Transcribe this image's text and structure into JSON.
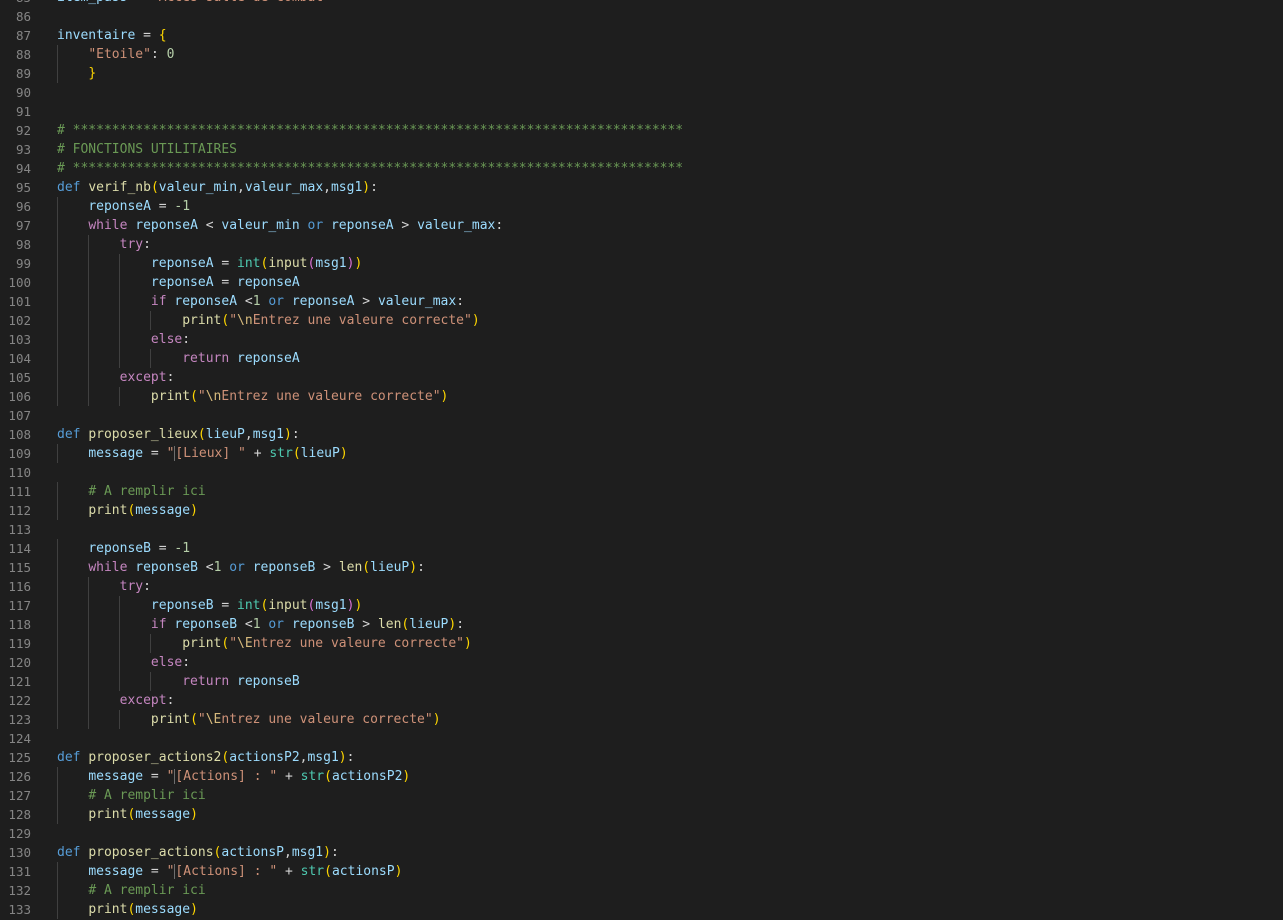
{
  "editor": {
    "background": "#1e1e1e",
    "language": "python",
    "first_line_number": 85,
    "palette": {
      "kw": "#569cd6",
      "ctl": "#c586c0",
      "fn": "#dcdcaa",
      "var": "#9cdcfe",
      "str": "#ce9178",
      "num": "#b5cea8",
      "cmt": "#6a9955",
      "bi": "#4ec9b0",
      "br1": "#ffd700",
      "br2": "#da70d6",
      "br3": "#179fff",
      "esc": "#d7ba7d"
    },
    "lines": [
      {
        "n": "85",
        "indent": 0,
        "tokens": [
          [
            "var",
            "item_pass"
          ],
          [
            "op",
            " = "
          ],
          [
            "str",
            "\"Accès salle de combat\""
          ]
        ]
      },
      {
        "n": "86",
        "indent": 0,
        "tokens": []
      },
      {
        "n": "87",
        "indent": 0,
        "tokens": [
          [
            "var",
            "inventaire"
          ],
          [
            "op",
            " = "
          ],
          [
            "br1",
            "{"
          ]
        ]
      },
      {
        "n": "88",
        "indent": 1,
        "tokens": [
          [
            "str",
            "\"Etoile\""
          ],
          [
            "op",
            ": "
          ],
          [
            "num",
            "0"
          ]
        ]
      },
      {
        "n": "89",
        "indent": 1,
        "tokens": [
          [
            "br1",
            "}"
          ]
        ]
      },
      {
        "n": "90",
        "indent": 0,
        "tokens": []
      },
      {
        "n": "91",
        "indent": 0,
        "tokens": []
      },
      {
        "n": "92",
        "indent": 0,
        "tokens": [
          [
            "cmt",
            "# ******************************************************************************"
          ]
        ]
      },
      {
        "n": "93",
        "indent": 0,
        "tokens": [
          [
            "cmt",
            "# FONCTIONS UTILITAIRES"
          ]
        ]
      },
      {
        "n": "94",
        "indent": 0,
        "tokens": [
          [
            "cmt",
            "# ******************************************************************************"
          ]
        ]
      },
      {
        "n": "95",
        "indent": 0,
        "tokens": [
          [
            "kw",
            "def"
          ],
          [
            "op",
            " "
          ],
          [
            "fn",
            "verif_nb"
          ],
          [
            "br1",
            "("
          ],
          [
            "var",
            "valeur_min"
          ],
          [
            "op",
            ","
          ],
          [
            "var",
            "valeur_max"
          ],
          [
            "op",
            ","
          ],
          [
            "var",
            "msg1"
          ],
          [
            "br1",
            ")"
          ],
          [
            "op",
            ":"
          ]
        ]
      },
      {
        "n": "96",
        "indent": 1,
        "tokens": [
          [
            "var",
            "reponseA"
          ],
          [
            "op",
            " = "
          ],
          [
            "num",
            "-1"
          ]
        ]
      },
      {
        "n": "97",
        "indent": 1,
        "tokens": [
          [
            "ctl",
            "while"
          ],
          [
            "op",
            " "
          ],
          [
            "var",
            "reponseA"
          ],
          [
            "op",
            " < "
          ],
          [
            "var",
            "valeur_min"
          ],
          [
            "op",
            " "
          ],
          [
            "kw",
            "or"
          ],
          [
            "op",
            " "
          ],
          [
            "var",
            "reponseA"
          ],
          [
            "op",
            " > "
          ],
          [
            "var",
            "valeur_max"
          ],
          [
            "op",
            ":"
          ]
        ]
      },
      {
        "n": "98",
        "indent": 2,
        "tokens": [
          [
            "ctl",
            "try"
          ],
          [
            "op",
            ":"
          ]
        ]
      },
      {
        "n": "99",
        "indent": 3,
        "tokens": [
          [
            "var",
            "reponseA"
          ],
          [
            "op",
            " = "
          ],
          [
            "bi",
            "int"
          ],
          [
            "br1",
            "("
          ],
          [
            "fn",
            "input"
          ],
          [
            "br2",
            "("
          ],
          [
            "var",
            "msg1"
          ],
          [
            "br2",
            ")"
          ],
          [
            "br1",
            ")"
          ]
        ]
      },
      {
        "n": "100",
        "indent": 3,
        "tokens": [
          [
            "var",
            "reponseA"
          ],
          [
            "op",
            " = "
          ],
          [
            "var",
            "reponseA"
          ]
        ]
      },
      {
        "n": "101",
        "indent": 3,
        "tokens": [
          [
            "ctl",
            "if"
          ],
          [
            "op",
            " "
          ],
          [
            "var",
            "reponseA"
          ],
          [
            "op",
            " <"
          ],
          [
            "num",
            "1"
          ],
          [
            "op",
            " "
          ],
          [
            "kw",
            "or"
          ],
          [
            "op",
            " "
          ],
          [
            "var",
            "reponseA"
          ],
          [
            "op",
            " > "
          ],
          [
            "var",
            "valeur_max"
          ],
          [
            "op",
            ":"
          ]
        ]
      },
      {
        "n": "102",
        "indent": 4,
        "tokens": [
          [
            "fn",
            "print"
          ],
          [
            "br1",
            "("
          ],
          [
            "str",
            "\""
          ],
          [
            "esc",
            "\\n"
          ],
          [
            "str",
            "Entrez une valeure correcte\""
          ],
          [
            "br1",
            ")"
          ]
        ]
      },
      {
        "n": "103",
        "indent": 3,
        "tokens": [
          [
            "ctl",
            "else"
          ],
          [
            "op",
            ":"
          ]
        ]
      },
      {
        "n": "104",
        "indent": 4,
        "tokens": [
          [
            "ctl",
            "return"
          ],
          [
            "op",
            " "
          ],
          [
            "var",
            "reponseA"
          ]
        ]
      },
      {
        "n": "105",
        "indent": 2,
        "tokens": [
          [
            "ctl",
            "except"
          ],
          [
            "op",
            ":"
          ]
        ]
      },
      {
        "n": "106",
        "indent": 3,
        "tokens": [
          [
            "fn",
            "print"
          ],
          [
            "br1",
            "("
          ],
          [
            "str",
            "\""
          ],
          [
            "esc",
            "\\n"
          ],
          [
            "str",
            "Entrez une valeure correcte\""
          ],
          [
            "br1",
            ")"
          ]
        ]
      },
      {
        "n": "107",
        "indent": 0,
        "tokens": []
      },
      {
        "n": "108",
        "indent": 0,
        "tokens": [
          [
            "kw",
            "def"
          ],
          [
            "op",
            " "
          ],
          [
            "fn",
            "proposer_lieux"
          ],
          [
            "br1",
            "("
          ],
          [
            "var",
            "lieuP"
          ],
          [
            "op",
            ","
          ],
          [
            "var",
            "msg1"
          ],
          [
            "br1",
            ")"
          ],
          [
            "op",
            ":"
          ]
        ]
      },
      {
        "n": "109",
        "indent": 1,
        "tokens": [
          [
            "var",
            "message"
          ],
          [
            "op",
            " = "
          ],
          [
            "str",
            "\""
          ],
          [
            "cur",
            ""
          ],
          [
            "str",
            "[Lieux] \""
          ],
          [
            "op",
            " + "
          ],
          [
            "bi",
            "str"
          ],
          [
            "br1",
            "("
          ],
          [
            "var",
            "lieuP"
          ],
          [
            "br1",
            ")"
          ]
        ]
      },
      {
        "n": "110",
        "indent": 0,
        "tokens": []
      },
      {
        "n": "111",
        "indent": 1,
        "tokens": [
          [
            "cmt",
            "# A remplir ici"
          ]
        ]
      },
      {
        "n": "112",
        "indent": 1,
        "tokens": [
          [
            "fn",
            "print"
          ],
          [
            "br1",
            "("
          ],
          [
            "var",
            "message"
          ],
          [
            "br1",
            ")"
          ]
        ]
      },
      {
        "n": "113",
        "indent": 0,
        "tokens": []
      },
      {
        "n": "114",
        "indent": 1,
        "tokens": [
          [
            "var",
            "reponseB"
          ],
          [
            "op",
            " = "
          ],
          [
            "num",
            "-1"
          ]
        ]
      },
      {
        "n": "115",
        "indent": 1,
        "tokens": [
          [
            "ctl",
            "while"
          ],
          [
            "op",
            " "
          ],
          [
            "var",
            "reponseB"
          ],
          [
            "op",
            " <"
          ],
          [
            "num",
            "1"
          ],
          [
            "op",
            " "
          ],
          [
            "kw",
            "or"
          ],
          [
            "op",
            " "
          ],
          [
            "var",
            "reponseB"
          ],
          [
            "op",
            " > "
          ],
          [
            "fn",
            "len"
          ],
          [
            "br1",
            "("
          ],
          [
            "var",
            "lieuP"
          ],
          [
            "br1",
            ")"
          ],
          [
            "op",
            ":"
          ]
        ]
      },
      {
        "n": "116",
        "indent": 2,
        "tokens": [
          [
            "ctl",
            "try"
          ],
          [
            "op",
            ":"
          ]
        ]
      },
      {
        "n": "117",
        "indent": 3,
        "tokens": [
          [
            "var",
            "reponseB"
          ],
          [
            "op",
            " = "
          ],
          [
            "bi",
            "int"
          ],
          [
            "br1",
            "("
          ],
          [
            "fn",
            "input"
          ],
          [
            "br2",
            "("
          ],
          [
            "var",
            "msg1"
          ],
          [
            "br2",
            ")"
          ],
          [
            "br1",
            ")"
          ]
        ]
      },
      {
        "n": "118",
        "indent": 3,
        "tokens": [
          [
            "ctl",
            "if"
          ],
          [
            "op",
            " "
          ],
          [
            "var",
            "reponseB"
          ],
          [
            "op",
            " <"
          ],
          [
            "num",
            "1"
          ],
          [
            "op",
            " "
          ],
          [
            "kw",
            "or"
          ],
          [
            "op",
            " "
          ],
          [
            "var",
            "reponseB"
          ],
          [
            "op",
            " > "
          ],
          [
            "fn",
            "len"
          ],
          [
            "br1",
            "("
          ],
          [
            "var",
            "lieuP"
          ],
          [
            "br1",
            ")"
          ],
          [
            "op",
            ":"
          ]
        ]
      },
      {
        "n": "119",
        "indent": 4,
        "tokens": [
          [
            "fn",
            "print"
          ],
          [
            "br1",
            "("
          ],
          [
            "str",
            "\""
          ],
          [
            "esc",
            "\\E"
          ],
          [
            "str",
            "ntrez une valeure correcte\""
          ],
          [
            "br1",
            ")"
          ]
        ]
      },
      {
        "n": "120",
        "indent": 3,
        "tokens": [
          [
            "ctl",
            "else"
          ],
          [
            "op",
            ":"
          ]
        ]
      },
      {
        "n": "121",
        "indent": 4,
        "tokens": [
          [
            "ctl",
            "return"
          ],
          [
            "op",
            " "
          ],
          [
            "var",
            "reponseB"
          ]
        ]
      },
      {
        "n": "122",
        "indent": 2,
        "tokens": [
          [
            "ctl",
            "except"
          ],
          [
            "op",
            ":"
          ]
        ]
      },
      {
        "n": "123",
        "indent": 3,
        "tokens": [
          [
            "fn",
            "print"
          ],
          [
            "br1",
            "("
          ],
          [
            "str",
            "\""
          ],
          [
            "esc",
            "\\E"
          ],
          [
            "str",
            "ntrez une valeure correcte\""
          ],
          [
            "br1",
            ")"
          ]
        ]
      },
      {
        "n": "124",
        "indent": 0,
        "tokens": []
      },
      {
        "n": "125",
        "indent": 0,
        "tokens": [
          [
            "kw",
            "def"
          ],
          [
            "op",
            " "
          ],
          [
            "fn",
            "proposer_actions2"
          ],
          [
            "br1",
            "("
          ],
          [
            "var",
            "actionsP2"
          ],
          [
            "op",
            ","
          ],
          [
            "var",
            "msg1"
          ],
          [
            "br1",
            ")"
          ],
          [
            "op",
            ":"
          ]
        ]
      },
      {
        "n": "126",
        "indent": 1,
        "tokens": [
          [
            "var",
            "message"
          ],
          [
            "op",
            " = "
          ],
          [
            "str",
            "\""
          ],
          [
            "cur",
            ""
          ],
          [
            "str",
            "[Actions] : \""
          ],
          [
            "op",
            " + "
          ],
          [
            "bi",
            "str"
          ],
          [
            "br1",
            "("
          ],
          [
            "var",
            "actionsP2"
          ],
          [
            "br1",
            ")"
          ]
        ]
      },
      {
        "n": "127",
        "indent": 1,
        "tokens": [
          [
            "cmt",
            "# A remplir ici"
          ]
        ]
      },
      {
        "n": "128",
        "indent": 1,
        "tokens": [
          [
            "fn",
            "print"
          ],
          [
            "br1",
            "("
          ],
          [
            "var",
            "message"
          ],
          [
            "br1",
            ")"
          ]
        ]
      },
      {
        "n": "129",
        "indent": 0,
        "tokens": []
      },
      {
        "n": "130",
        "indent": 0,
        "tokens": [
          [
            "kw",
            "def"
          ],
          [
            "op",
            " "
          ],
          [
            "fn",
            "proposer_actions"
          ],
          [
            "br1",
            "("
          ],
          [
            "var",
            "actionsP"
          ],
          [
            "op",
            ","
          ],
          [
            "var",
            "msg1"
          ],
          [
            "br1",
            ")"
          ],
          [
            "op",
            ":"
          ]
        ]
      },
      {
        "n": "131",
        "indent": 1,
        "tokens": [
          [
            "var",
            "message"
          ],
          [
            "op",
            " = "
          ],
          [
            "str",
            "\""
          ],
          [
            "cur",
            ""
          ],
          [
            "str",
            "[Actions] : \""
          ],
          [
            "op",
            " + "
          ],
          [
            "bi",
            "str"
          ],
          [
            "br1",
            "("
          ],
          [
            "var",
            "actionsP"
          ],
          [
            "br1",
            ")"
          ]
        ]
      },
      {
        "n": "132",
        "indent": 1,
        "tokens": [
          [
            "cmt",
            "# A remplir ici"
          ]
        ]
      },
      {
        "n": "133",
        "indent": 1,
        "tokens": [
          [
            "fn",
            "print"
          ],
          [
            "br1",
            "("
          ],
          [
            "var",
            "message"
          ],
          [
            "br1",
            ")"
          ]
        ]
      }
    ]
  }
}
